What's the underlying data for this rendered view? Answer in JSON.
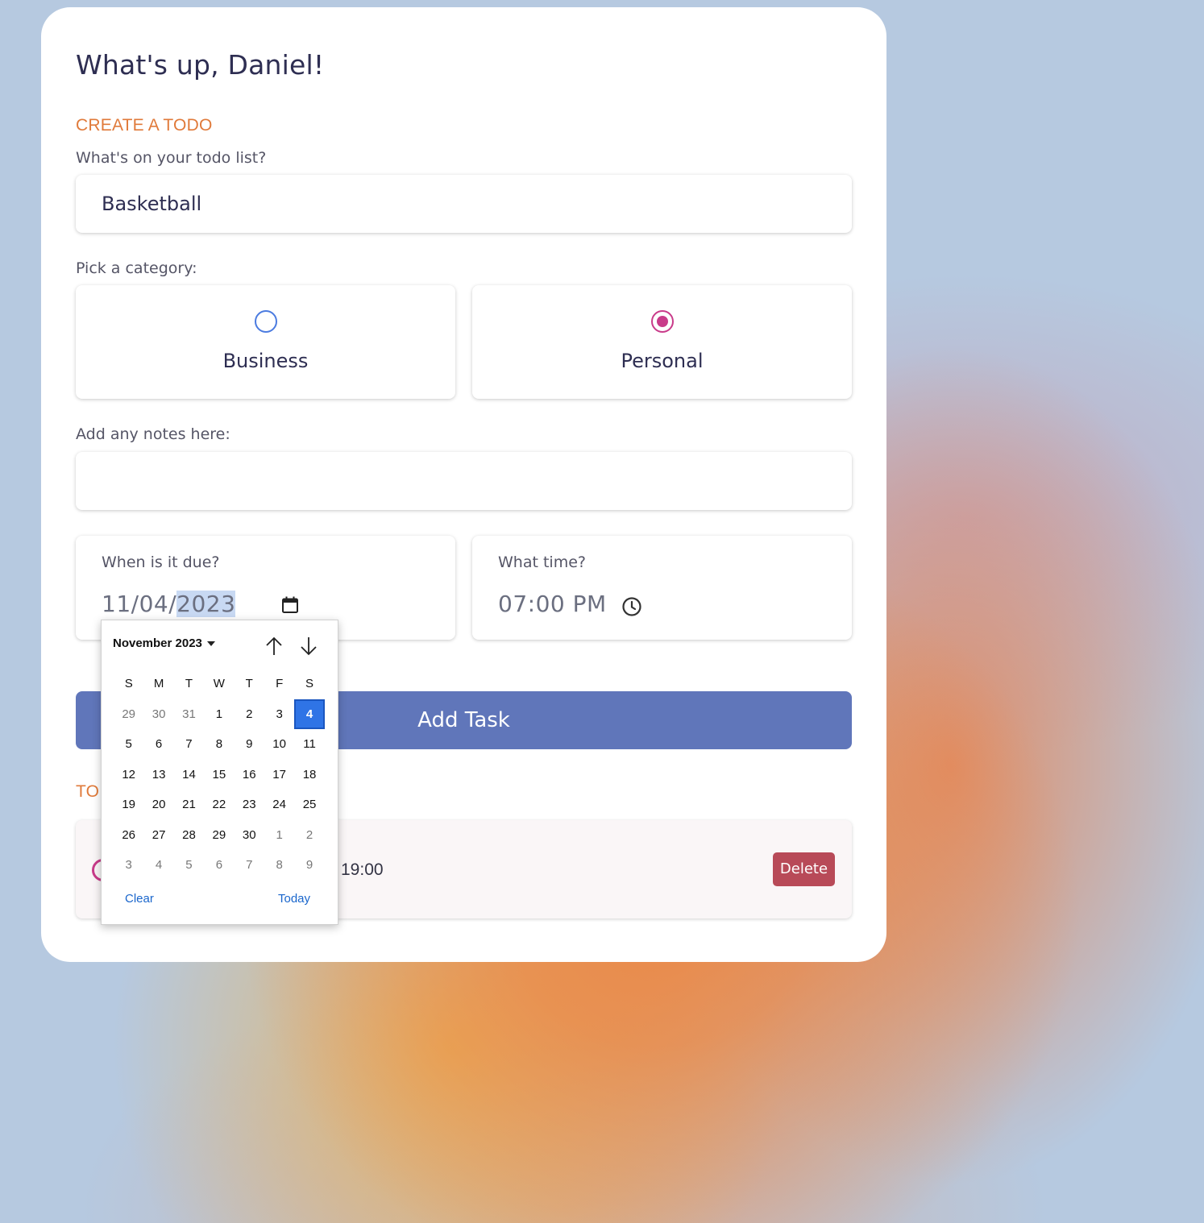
{
  "header": {
    "greeting": "What's up, Daniel!"
  },
  "create": {
    "section_title": "CREATE A TODO",
    "todo_label": "What's on your todo list?",
    "todo_value": "Basketball",
    "category_label": "Pick a category:",
    "categories": [
      {
        "label": "Business",
        "checked": false,
        "color": "#4b7be0"
      },
      {
        "label": "Personal",
        "checked": true,
        "color": "#c93b8a"
      }
    ],
    "notes_label": "Add any notes here:",
    "notes_value": "",
    "date_label": "When is it due?",
    "date_prefix": "11/04/",
    "date_selected_part": "2023",
    "time_label": "What time?",
    "time_value": "07:00 PM",
    "add_button": "Add Task"
  },
  "todo_list": {
    "section_title_partial": "TO",
    "items": [
      {
        "time": "19:00",
        "delete_label": "Delete"
      }
    ]
  },
  "calendar": {
    "month_label": "November 2023",
    "weekdays": [
      "S",
      "M",
      "T",
      "W",
      "T",
      "F",
      "S"
    ],
    "days": [
      {
        "d": "29",
        "m": true
      },
      {
        "d": "30",
        "m": true
      },
      {
        "d": "31",
        "m": true
      },
      {
        "d": "1"
      },
      {
        "d": "2"
      },
      {
        "d": "3"
      },
      {
        "d": "4",
        "sel": true
      },
      {
        "d": "5"
      },
      {
        "d": "6"
      },
      {
        "d": "7"
      },
      {
        "d": "8"
      },
      {
        "d": "9"
      },
      {
        "d": "10"
      },
      {
        "d": "11"
      },
      {
        "d": "12"
      },
      {
        "d": "13"
      },
      {
        "d": "14"
      },
      {
        "d": "15"
      },
      {
        "d": "16"
      },
      {
        "d": "17"
      },
      {
        "d": "18"
      },
      {
        "d": "19"
      },
      {
        "d": "20"
      },
      {
        "d": "21"
      },
      {
        "d": "22"
      },
      {
        "d": "23"
      },
      {
        "d": "24"
      },
      {
        "d": "25"
      },
      {
        "d": "26"
      },
      {
        "d": "27"
      },
      {
        "d": "28"
      },
      {
        "d": "29"
      },
      {
        "d": "30"
      },
      {
        "d": "1",
        "m": true
      },
      {
        "d": "2",
        "m": true
      },
      {
        "d": "3",
        "m": true
      },
      {
        "d": "4",
        "m": true
      },
      {
        "d": "5",
        "m": true
      },
      {
        "d": "6",
        "m": true
      },
      {
        "d": "7",
        "m": true
      },
      {
        "d": "8",
        "m": true
      },
      {
        "d": "9",
        "m": true
      }
    ],
    "clear_label": "Clear",
    "today_label": "Today",
    "icons": {
      "prev": "arrow-up-icon",
      "next": "arrow-down-icon",
      "caret": "caret-down-icon"
    }
  },
  "colors": {
    "accent": "#e07a3a",
    "primary_button": "#6076ba",
    "delete_button": "#b84a58",
    "calendar_selected": "#2f74e6"
  }
}
